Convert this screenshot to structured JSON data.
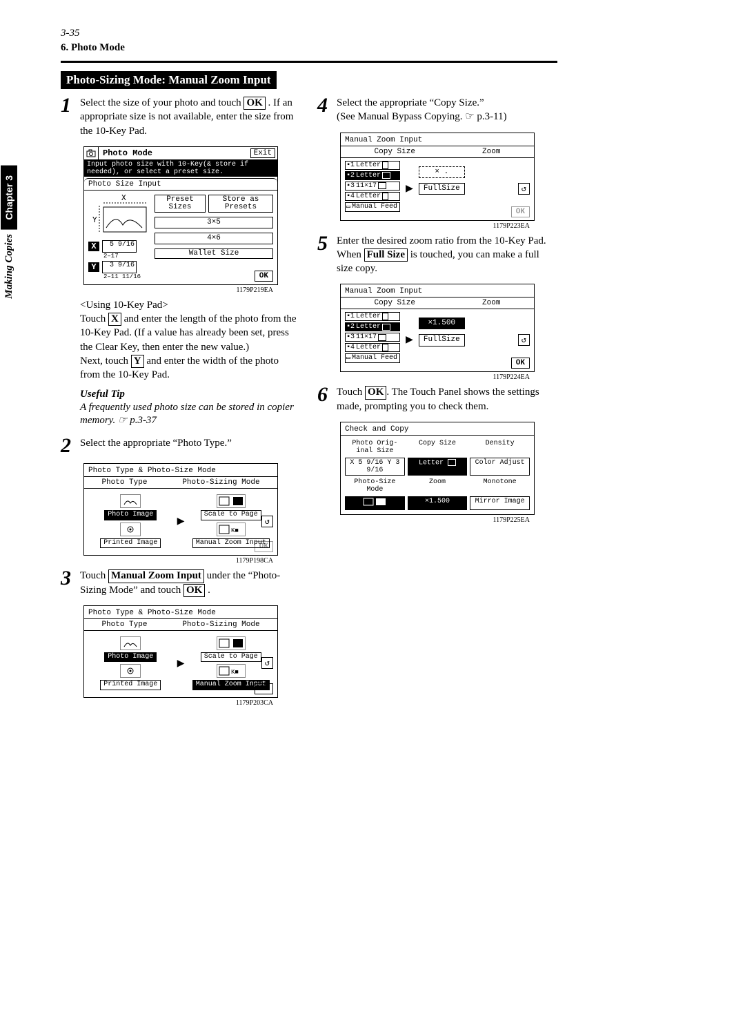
{
  "page_number_label": "3-35",
  "section": "6. Photo Mode",
  "side_chapter": "Chapter 3",
  "side_label": "Making Copies",
  "heading": "Photo-Sizing Mode: Manual Zoom Input",
  "step1": {
    "pre": "Select the size of your photo and touch ",
    "ok": "OK",
    "post": " . If an appropriate size is not available, enter the size from the 10-Key Pad.",
    "using": "<Using 10-Key Pad>",
    "touch_pre": "Touch ",
    "x": "X",
    "touch_mid": " and enter the length of the photo from the 10-Key Pad. (If a value has already been set, press the Clear Key, then enter the new value.)",
    "next_pre": "Next, touch ",
    "y": "Y",
    "next_post": " and enter the width of the photo from the 10-Key Pad."
  },
  "tip": {
    "head": "Useful Tip",
    "text": "A frequently used photo size can be stored in copier memory. ☞ p.3-37"
  },
  "step2": "Select the appropriate “Photo Type.”",
  "step3": {
    "pre": "Touch ",
    "btn": "Manual Zoom Input",
    "mid": " under the “Photo-Sizing Mode” and touch ",
    "ok": "OK",
    "post": " ."
  },
  "step4": {
    "l1": "Select the appropriate “Copy Size.”",
    "l2": "(See Manual Bypass Copying.  ☞ p.3-11)"
  },
  "step5": {
    "l1_pre": "Enter the desired zoom ratio from the 10-Key Pad.",
    "l2_pre": "When ",
    "full": "Full Size",
    "l2_post": " is touched, you can make a full size copy."
  },
  "step6": {
    "pre": "Touch ",
    "ok": "OK",
    "post": ". The Touch Panel shows the settings made, prompting you to check them."
  },
  "panel1": {
    "title": "Photo Mode",
    "exit": "Exit",
    "msg": "Input photo size with 10-Key(& store if needed), or select a preset size.",
    "sub": "Photo Size Input",
    "preset": "Preset Sizes",
    "store": "Store as Presets",
    "p35": "3×5",
    "p46": "4×6",
    "wallet": "Wallet Size",
    "ok": "OK",
    "x_val": "5  9/16",
    "x_range": "2–17",
    "y_val": "3  9/16",
    "y_range": "2–11 11/16",
    "caption": "1179P219EA"
  },
  "panel2": {
    "title": "Photo Type & Photo-Size Mode",
    "col1": "Photo Type",
    "col2": "Photo-Sizing Mode",
    "photo_image": "Photo Image",
    "printed_image": "Printed Image",
    "scale": "Scale to Page",
    "manual": "Manual Zoom Input",
    "caption": "1179P198CA"
  },
  "panel3": {
    "title": "Photo Type & Photo-Size Mode",
    "col1": "Photo Type",
    "col2": "Photo-Sizing Mode",
    "photo_image": "Photo Image",
    "printed_image": "Printed Image",
    "scale": "Scale to Page",
    "manual": "Manual Zoom Input",
    "ok": "OK",
    "caption": "1179P203CA"
  },
  "panel4": {
    "title": "Manual Zoom Input",
    "col1": "Copy Size",
    "col2": "Zoom",
    "letter_p": "Letter",
    "letter_l": "Letter",
    "s11x17": "11×17",
    "letter_p2": "Letter",
    "manual_feed": "Manual Feed",
    "x_blank": "×   .",
    "fullsize": "FullSize",
    "ok": "OK",
    "caption": "1179P223EA"
  },
  "panel5": {
    "title": "Manual Zoom Input",
    "col1": "Copy Size",
    "col2": "Zoom",
    "letter_p": "Letter",
    "letter_l": "Letter",
    "s11x17": "11×17",
    "letter_p2": "Letter",
    "manual_feed": "Manual Feed",
    "x_val": "×1.500",
    "fullsize": "FullSize",
    "ok": "OK",
    "caption": "1179P224EA"
  },
  "panel6": {
    "title": "Check and Copy",
    "h1": "Photo Orig-inal Size",
    "h2": "Copy Size",
    "h3": "Density",
    "r1a": "X 5 9/16 Y 3 9/16",
    "r1b": "Letter",
    "r1c": "Color Adjust",
    "h4": "Photo-Size Mode",
    "h5": "Zoom",
    "h6": "Monotone",
    "r2a": "",
    "r2b": "×1.500",
    "r2c": "Mirror Image",
    "caption": "1179P225EA"
  },
  "numbers": {
    "n1": "1",
    "n2": "2",
    "n3": "3",
    "n4": "4",
    "n5": "5",
    "n6": "6"
  },
  "labels": {
    "x_axis": "X",
    "y_axis": "Y",
    "undo": "↺"
  }
}
